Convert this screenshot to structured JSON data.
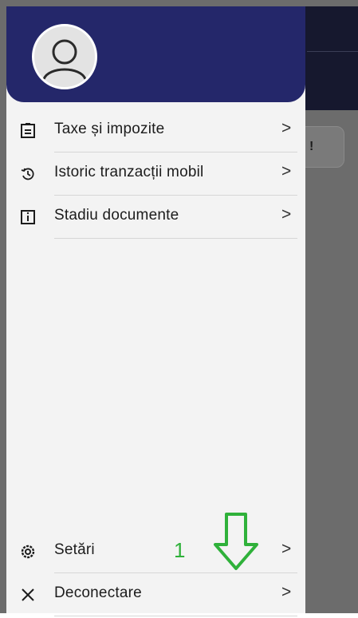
{
  "menu": {
    "items": [
      {
        "label": "Taxe și impozite",
        "icon": "document-list-icon",
        "chevron": ">"
      },
      {
        "label": "Istoric tranzacții mobil",
        "icon": "history-icon",
        "chevron": ">"
      },
      {
        "label": "Stadiu documente",
        "icon": "info-box-icon",
        "chevron": ">"
      }
    ],
    "bottom_items": [
      {
        "label": "Setări",
        "icon": "gear-icon",
        "chevron": ">"
      },
      {
        "label": "Deconectare",
        "icon": "close-icon",
        "chevron": ">"
      }
    ]
  },
  "background": {
    "card_text": "!"
  },
  "annotation": {
    "number": "1",
    "color": "#2fb13a"
  },
  "colors": {
    "header": "#24276a",
    "drawer": "#f3f3f3",
    "overlay": "#6c6c6c"
  }
}
